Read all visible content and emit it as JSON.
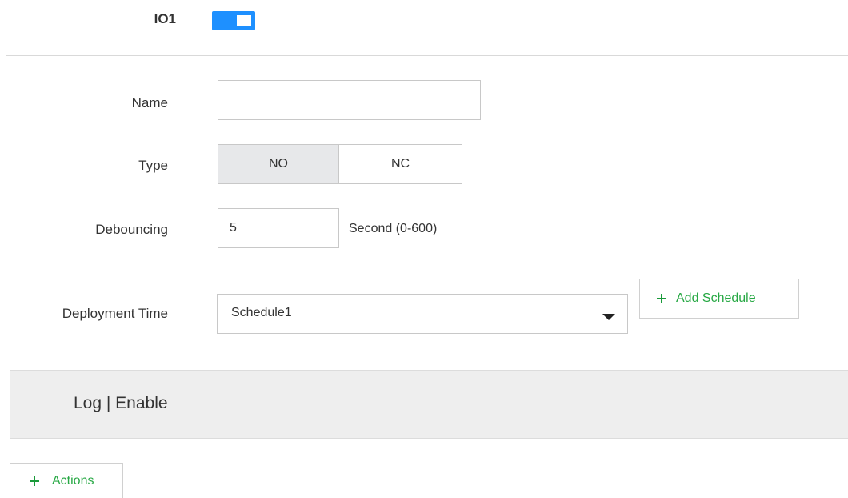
{
  "io": {
    "label": "IO1",
    "enabled": true
  },
  "form": {
    "name": {
      "label": "Name",
      "value": "",
      "placeholder": ""
    },
    "type": {
      "label": "Type",
      "options": [
        "NO",
        "NC"
      ],
      "selected": "NO"
    },
    "debouncing": {
      "label": "Debouncing",
      "value": "5",
      "unit": "Second (0-600)"
    },
    "deployment_time": {
      "label": "Deployment Time",
      "selected": "Schedule1",
      "add_schedule_label": "Add Schedule"
    }
  },
  "log_panel": {
    "title": "Log | Enable"
  },
  "actions_button": {
    "label": "Actions"
  },
  "colors": {
    "toggle_on": "#1e90ff",
    "accent_green": "#27a844",
    "active_segment": "#e7e8ea",
    "panel_bg": "#eeeeee"
  }
}
